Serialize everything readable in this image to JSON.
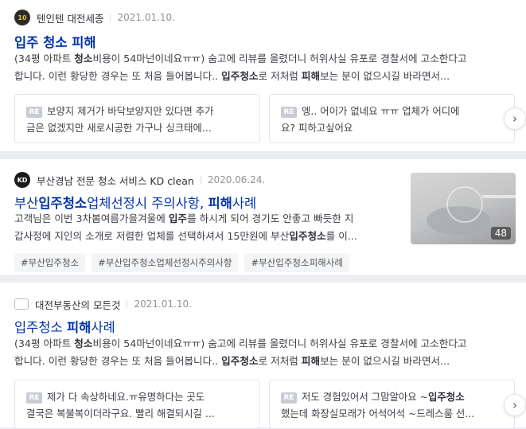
{
  "results": [
    {
      "author": "텐인텐 대전세종",
      "date": "2021.01.10.",
      "avatar_text": "10",
      "title": "입주 청소 피해",
      "desc_lines": [
        [
          [
            "(34평 아파트 ",
            false
          ],
          [
            "청소",
            true
          ],
          [
            "비용이 54마넌이네요ㅠㅠ) 숨고에 리뷰를 올렸더니 허위사실 유포로 경찰서에 고소한다고",
            false
          ]
        ],
        [
          [
            "합니다. 이런 황당한 경우는 또 처음 들어봅니다.. ",
            false
          ],
          [
            "입주청소",
            true
          ],
          [
            "로 저처럼 ",
            false
          ],
          [
            "피해",
            true
          ],
          [
            "보는 분이 없으시길 바라면서...",
            false
          ]
        ]
      ],
      "replies": [
        {
          "badge": "RE",
          "lines": [
            [
              [
                "보양지 제거가 바닥보양지만 있다면 추가",
                false
              ]
            ],
            [
              [
                "금은 없겠지만 새로시공한 가구나 싱크태에...",
                false
              ]
            ]
          ]
        },
        {
          "badge": "RE",
          "lines": [
            [
              [
                "엥.. 어이가 없네요 ㅠㅠ 업체가 어디에",
                false
              ]
            ],
            [
              [
                "요? 피하고싶어요",
                false
              ]
            ]
          ]
        }
      ]
    },
    {
      "author": "부산경남 전문 청소 서비스 KD clean",
      "date": "2020.06.24.",
      "avatar_text": "KD",
      "title_parts": [
        [
          "부산",
          false
        ],
        [
          "입주청소",
          true
        ],
        [
          "업체선정시 주의사항, ",
          false
        ],
        [
          "피해",
          true
        ],
        [
          "사례",
          false
        ]
      ],
      "desc_lines": [
        [
          [
            "고객님은 이번 3차봄여름가을겨울에 ",
            false
          ],
          [
            "입주",
            true
          ],
          [
            "를 하시게 되어 경기도 안좋고 빠듯한 지",
            false
          ]
        ],
        [
          [
            "갑사정에 지인의 소개로 저렴한 업체를 선택하셔서 15만원에 부산",
            false
          ],
          [
            "입주청소",
            true
          ],
          [
            "를 이...",
            false
          ]
        ]
      ],
      "thumb_count": "48",
      "tags": [
        "#부산입주청소",
        "#부산입주청소업체선정시주의사항",
        "#부산입주청소피해사례"
      ]
    },
    {
      "author": "대전부동산의 모든것",
      "date": "2021.01.10.",
      "title_parts": [
        [
          "입주청소 ",
          false
        ],
        [
          "피해",
          true
        ],
        [
          "사례",
          false
        ]
      ],
      "desc_lines": [
        [
          [
            "(34평 아파트 ",
            false
          ],
          [
            "청소",
            true
          ],
          [
            "비용이 54마넌이네요ㅠㅠ) 숨고에 리뷰를 올렸더니 허위사실 유포로 경찰서에 고소한다고",
            false
          ]
        ],
        [
          [
            "합니다. 이런 황당한 경우는 또 처음 들어봅니다.. ",
            false
          ],
          [
            "입주청소",
            true
          ],
          [
            "로 저처럼 ",
            false
          ],
          [
            "피해",
            true
          ],
          [
            "보는 분이 없으시길 바라면서...",
            false
          ]
        ]
      ],
      "replies": [
        {
          "badge": "RE",
          "lines": [
            [
              [
                "제가 다 속상하네요.ㅠ유명하다는 곳도",
                false
              ]
            ],
            [
              [
                "결국은 복불복이더라구요. 빨리 해결되시길 ...",
                false
              ]
            ]
          ]
        },
        {
          "badge": "RE",
          "lines": [
            [
              [
                "저도 경험있어서 그맘알아요 ~",
                false
              ],
              [
                "입주청소",
                true
              ]
            ],
            [
              [
                "했는데 화장실모래가 어석어석 ~드레스룸 선...",
                false
              ]
            ]
          ]
        }
      ]
    }
  ],
  "arrow_icon": "chevron-right-icon"
}
